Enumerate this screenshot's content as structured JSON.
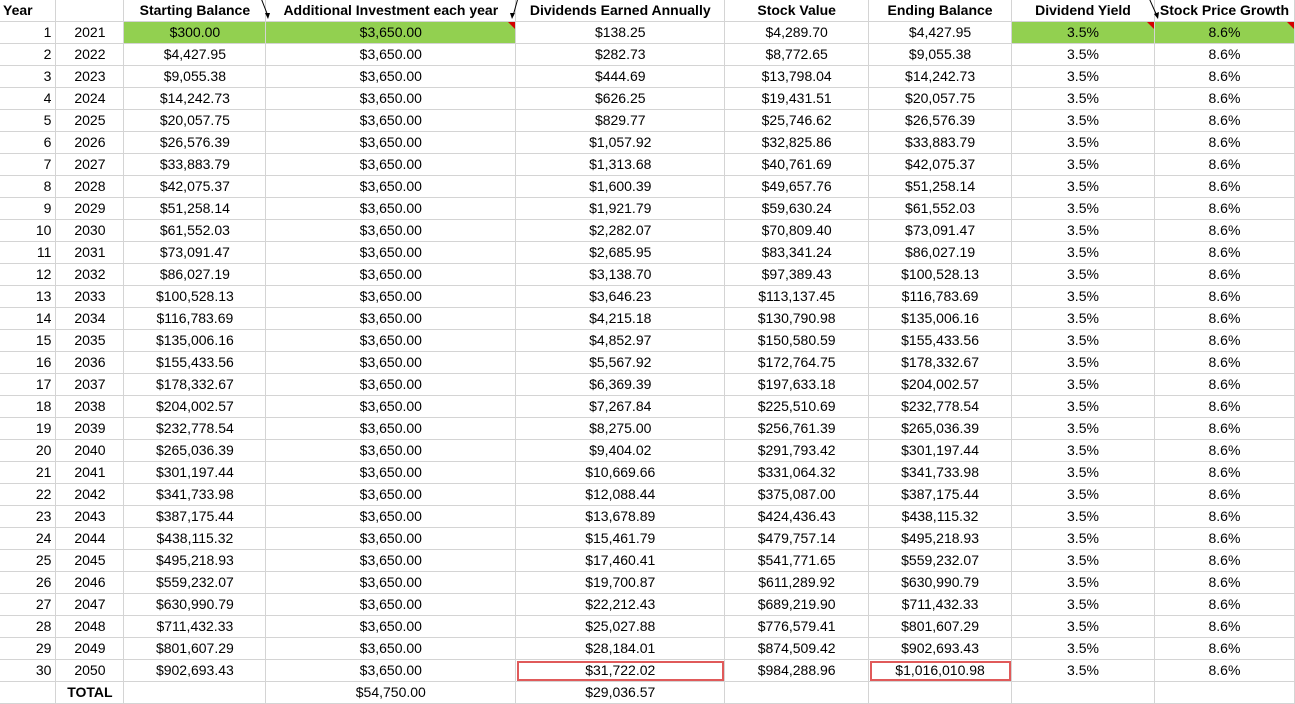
{
  "headers": {
    "year": "Year",
    "starting_balance": "Starting Balance",
    "additional_investment": "Additional Investment each year",
    "dividends": "Dividends Earned Annually",
    "stock_value": "Stock Value",
    "ending_balance": "Ending Balance",
    "dividend_yield": "Dividend Yield",
    "stock_price_growth": "Stock Price Growth"
  },
  "rows": [
    [
      "1",
      "2021",
      "$300.00",
      "$3,650.00",
      "$138.25",
      "$4,289.70",
      "$4,427.95",
      "3.5%",
      "8.6%"
    ],
    [
      "2",
      "2022",
      "$4,427.95",
      "$3,650.00",
      "$282.73",
      "$8,772.65",
      "$9,055.38",
      "3.5%",
      "8.6%"
    ],
    [
      "3",
      "2023",
      "$9,055.38",
      "$3,650.00",
      "$444.69",
      "$13,798.04",
      "$14,242.73",
      "3.5%",
      "8.6%"
    ],
    [
      "4",
      "2024",
      "$14,242.73",
      "$3,650.00",
      "$626.25",
      "$19,431.51",
      "$20,057.75",
      "3.5%",
      "8.6%"
    ],
    [
      "5",
      "2025",
      "$20,057.75",
      "$3,650.00",
      "$829.77",
      "$25,746.62",
      "$26,576.39",
      "3.5%",
      "8.6%"
    ],
    [
      "6",
      "2026",
      "$26,576.39",
      "$3,650.00",
      "$1,057.92",
      "$32,825.86",
      "$33,883.79",
      "3.5%",
      "8.6%"
    ],
    [
      "7",
      "2027",
      "$33,883.79",
      "$3,650.00",
      "$1,313.68",
      "$40,761.69",
      "$42,075.37",
      "3.5%",
      "8.6%"
    ],
    [
      "8",
      "2028",
      "$42,075.37",
      "$3,650.00",
      "$1,600.39",
      "$49,657.76",
      "$51,258.14",
      "3.5%",
      "8.6%"
    ],
    [
      "9",
      "2029",
      "$51,258.14",
      "$3,650.00",
      "$1,921.79",
      "$59,630.24",
      "$61,552.03",
      "3.5%",
      "8.6%"
    ],
    [
      "10",
      "2030",
      "$61,552.03",
      "$3,650.00",
      "$2,282.07",
      "$70,809.40",
      "$73,091.47",
      "3.5%",
      "8.6%"
    ],
    [
      "11",
      "2031",
      "$73,091.47",
      "$3,650.00",
      "$2,685.95",
      "$83,341.24",
      "$86,027.19",
      "3.5%",
      "8.6%"
    ],
    [
      "12",
      "2032",
      "$86,027.19",
      "$3,650.00",
      "$3,138.70",
      "$97,389.43",
      "$100,528.13",
      "3.5%",
      "8.6%"
    ],
    [
      "13",
      "2033",
      "$100,528.13",
      "$3,650.00",
      "$3,646.23",
      "$113,137.45",
      "$116,783.69",
      "3.5%",
      "8.6%"
    ],
    [
      "14",
      "2034",
      "$116,783.69",
      "$3,650.00",
      "$4,215.18",
      "$130,790.98",
      "$135,006.16",
      "3.5%",
      "8.6%"
    ],
    [
      "15",
      "2035",
      "$135,006.16",
      "$3,650.00",
      "$4,852.97",
      "$150,580.59",
      "$155,433.56",
      "3.5%",
      "8.6%"
    ],
    [
      "16",
      "2036",
      "$155,433.56",
      "$3,650.00",
      "$5,567.92",
      "$172,764.75",
      "$178,332.67",
      "3.5%",
      "8.6%"
    ],
    [
      "17",
      "2037",
      "$178,332.67",
      "$3,650.00",
      "$6,369.39",
      "$197,633.18",
      "$204,002.57",
      "3.5%",
      "8.6%"
    ],
    [
      "18",
      "2038",
      "$204,002.57",
      "$3,650.00",
      "$7,267.84",
      "$225,510.69",
      "$232,778.54",
      "3.5%",
      "8.6%"
    ],
    [
      "19",
      "2039",
      "$232,778.54",
      "$3,650.00",
      "$8,275.00",
      "$256,761.39",
      "$265,036.39",
      "3.5%",
      "8.6%"
    ],
    [
      "20",
      "2040",
      "$265,036.39",
      "$3,650.00",
      "$9,404.02",
      "$291,793.42",
      "$301,197.44",
      "3.5%",
      "8.6%"
    ],
    [
      "21",
      "2041",
      "$301,197.44",
      "$3,650.00",
      "$10,669.66",
      "$331,064.32",
      "$341,733.98",
      "3.5%",
      "8.6%"
    ],
    [
      "22",
      "2042",
      "$341,733.98",
      "$3,650.00",
      "$12,088.44",
      "$375,087.00",
      "$387,175.44",
      "3.5%",
      "8.6%"
    ],
    [
      "23",
      "2043",
      "$387,175.44",
      "$3,650.00",
      "$13,678.89",
      "$424,436.43",
      "$438,115.32",
      "3.5%",
      "8.6%"
    ],
    [
      "24",
      "2044",
      "$438,115.32",
      "$3,650.00",
      "$15,461.79",
      "$479,757.14",
      "$495,218.93",
      "3.5%",
      "8.6%"
    ],
    [
      "25",
      "2045",
      "$495,218.93",
      "$3,650.00",
      "$17,460.41",
      "$541,771.65",
      "$559,232.07",
      "3.5%",
      "8.6%"
    ],
    [
      "26",
      "2046",
      "$559,232.07",
      "$3,650.00",
      "$19,700.87",
      "$611,289.92",
      "$630,990.79",
      "3.5%",
      "8.6%"
    ],
    [
      "27",
      "2047",
      "$630,990.79",
      "$3,650.00",
      "$22,212.43",
      "$689,219.90",
      "$711,432.33",
      "3.5%",
      "8.6%"
    ],
    [
      "28",
      "2048",
      "$711,432.33",
      "$3,650.00",
      "$25,027.88",
      "$776,579.41",
      "$801,607.29",
      "3.5%",
      "8.6%"
    ],
    [
      "29",
      "2049",
      "$801,607.29",
      "$3,650.00",
      "$28,184.01",
      "$874,509.42",
      "$902,693.43",
      "3.5%",
      "8.6%"
    ],
    [
      "30",
      "2050",
      "$902,693.43",
      "$3,650.00",
      "$31,722.02",
      "$984,288.96",
      "$1,016,010.98",
      "3.5%",
      "8.6%"
    ]
  ],
  "total": {
    "label": "TOTAL",
    "additional_investment": "$54,750.00",
    "dividends": "$29,036.57"
  },
  "highlight_colors": {
    "input_fill": "#92d050",
    "callout_border": "#e05a5a",
    "comment_marker": "#d40000"
  }
}
